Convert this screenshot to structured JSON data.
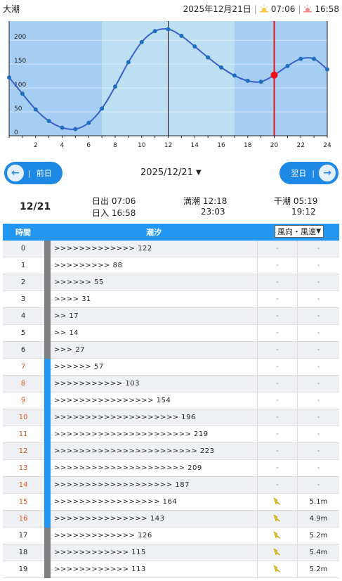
{
  "header": {
    "title": "大潮",
    "date": "2025年12月21日",
    "sunrise": "07:06",
    "sunset": "16:58"
  },
  "chart_data": {
    "type": "line",
    "x": [
      0,
      1,
      2,
      3,
      4,
      5,
      6,
      7,
      8,
      9,
      10,
      11,
      12,
      13,
      14,
      15,
      16,
      17,
      18,
      19,
      20,
      21,
      22,
      23,
      24
    ],
    "values": [
      122,
      88,
      55,
      31,
      17,
      14,
      27,
      57,
      103,
      154,
      196,
      219,
      223,
      209,
      187,
      164,
      143,
      126,
      115,
      113,
      127,
      146,
      161,
      161,
      139
    ],
    "xticks": [
      2,
      4,
      6,
      8,
      10,
      12,
      14,
      16,
      18,
      20,
      22,
      24
    ],
    "yticks": [
      0,
      50,
      100,
      150,
      200
    ],
    "xlim": [
      0,
      24
    ],
    "ylim": [
      0,
      240
    ],
    "daylight": [
      7,
      17
    ],
    "high_tide_marker": 12,
    "current_hour": 20,
    "colors": {
      "night": "#a6cdf2",
      "day": "#bddff2",
      "line": "#3a5fcd",
      "point": "#1f6fc0",
      "current": "#ee1111",
      "marker": "#000000"
    }
  },
  "nav": {
    "prev_label": "前日",
    "next_label": "翌日",
    "date_select": "2025/12/21"
  },
  "info": {
    "day": "12/21",
    "sunrise": "日出 07:06",
    "sunset": "日入 16:58",
    "high_tide_label": "満潮 12:18",
    "high_tide_2": "23:03",
    "low_tide_label": "干潮 05:19",
    "low_tide_2": "19:12"
  },
  "table": {
    "col_hour": "時間",
    "col_tide": "潮汐",
    "wind_select": "風向・風速",
    "rows": [
      {
        "hour": "0",
        "tide": ">>>>>>>>>>>>> 122",
        "dir": "-",
        "speed": "-",
        "red": false,
        "day": false
      },
      {
        "hour": "1",
        "tide": ">>>>>>>>> 88",
        "dir": "-",
        "speed": "-",
        "red": false,
        "day": false
      },
      {
        "hour": "2",
        "tide": ">>>>>> 55",
        "dir": "-",
        "speed": "-",
        "red": false,
        "day": false
      },
      {
        "hour": "3",
        "tide": ">>>> 31",
        "dir": "-",
        "speed": "-",
        "red": false,
        "day": false
      },
      {
        "hour": "4",
        "tide": ">> 17",
        "dir": "-",
        "speed": "-",
        "red": false,
        "day": false
      },
      {
        "hour": "5",
        "tide": ">> 14",
        "dir": "-",
        "speed": "-",
        "red": false,
        "day": false
      },
      {
        "hour": "6",
        "tide": ">>> 27",
        "dir": "-",
        "speed": "-",
        "red": false,
        "day": false
      },
      {
        "hour": "7",
        "tide": ">>>>>> 57",
        "dir": "-",
        "speed": "-",
        "red": true,
        "day": true
      },
      {
        "hour": "8",
        "tide": ">>>>>>>>>>> 103",
        "dir": "-",
        "speed": "-",
        "red": true,
        "day": true
      },
      {
        "hour": "9",
        "tide": ">>>>>>>>>>>>>>>> 154",
        "dir": "-",
        "speed": "-",
        "red": true,
        "day": true
      },
      {
        "hour": "10",
        "tide": ">>>>>>>>>>>>>>>>>>>> 196",
        "dir": "-",
        "speed": "-",
        "red": true,
        "day": true
      },
      {
        "hour": "11",
        "tide": ">>>>>>>>>>>>>>>>>>>>>> 219",
        "dir": "-",
        "speed": "-",
        "red": true,
        "day": true
      },
      {
        "hour": "12",
        "tide": ">>>>>>>>>>>>>>>>>>>>>>> 223",
        "dir": "-",
        "speed": "-",
        "red": true,
        "day": true
      },
      {
        "hour": "13",
        "tide": ">>>>>>>>>>>>>>>>>>>>> 209",
        "dir": "-",
        "speed": "-",
        "red": true,
        "day": true
      },
      {
        "hour": "14",
        "tide": ">>>>>>>>>>>>>>>>>>> 187",
        "dir": "-",
        "speed": "-",
        "red": true,
        "day": true
      },
      {
        "hour": "15",
        "tide": ">>>>>>>>>>>>>>>>> 164",
        "dir": "arrow",
        "speed": "5.1m",
        "red": true,
        "day": true
      },
      {
        "hour": "16",
        "tide": ">>>>>>>>>>>>>>> 143",
        "dir": "arrow",
        "speed": "4.9m",
        "red": true,
        "day": true
      },
      {
        "hour": "17",
        "tide": ">>>>>>>>>>>>> 126",
        "dir": "arrow",
        "speed": "5.2m",
        "red": false,
        "day": false
      },
      {
        "hour": "18",
        "tide": ">>>>>>>>>>>> 115",
        "dir": "arrow",
        "speed": "5.4m",
        "red": false,
        "day": false
      },
      {
        "hour": "19",
        "tide": ">>>>>>>>>>>> 113",
        "dir": "arrow",
        "speed": "5.2m",
        "red": false,
        "day": false
      }
    ]
  }
}
